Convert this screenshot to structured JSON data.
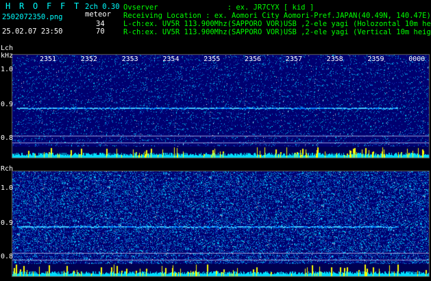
{
  "header": {
    "app_letters": [
      "H",
      "R",
      "O",
      "F",
      "F",
      "T"
    ],
    "filename": "2502072350.png",
    "datetime": "25.02.07 23:50",
    "version": "2ch 0.30",
    "meteor_label": "meteor",
    "meteor_l": "34",
    "meteor_r": "70",
    "observer": "Ovserver                : ex. JR7CYX [ kid ]",
    "location": "Receiving Location : ex. Aomori City Aomori-Pref.JAPAN(40.49N, 140.47E)",
    "lch_info": "L-ch:ex. UV5R 113.900Mhz(SAPPORO VOR)USB ,2-ele yagi (Holozontal 10m height)",
    "rch_info": "R-ch:ex. UV5R 113.900Mhz(SAPPORO VOR)USB ,2-ele yagi (Vertical 10m height)"
  },
  "panels": {
    "lch_label": "Lch",
    "khz_label": "kHz",
    "rch_label": "Rch",
    "time_ticks": [
      "2351",
      "2352",
      "2353",
      "2354",
      "2355",
      "2356",
      "2357",
      "2358",
      "2359",
      "0000"
    ],
    "freq_ticks_l": [
      "1.0",
      "0.9",
      "0.8"
    ],
    "freq_ticks_r": [
      "1.0",
      "0.9",
      "0.8"
    ]
  },
  "colors": {
    "header_cyan": "#00ffff",
    "header_green": "#00ff00",
    "spectrum_background": "#000088",
    "trace_cyan": "#00ffff",
    "trace_yellow": "#ffff00"
  }
}
